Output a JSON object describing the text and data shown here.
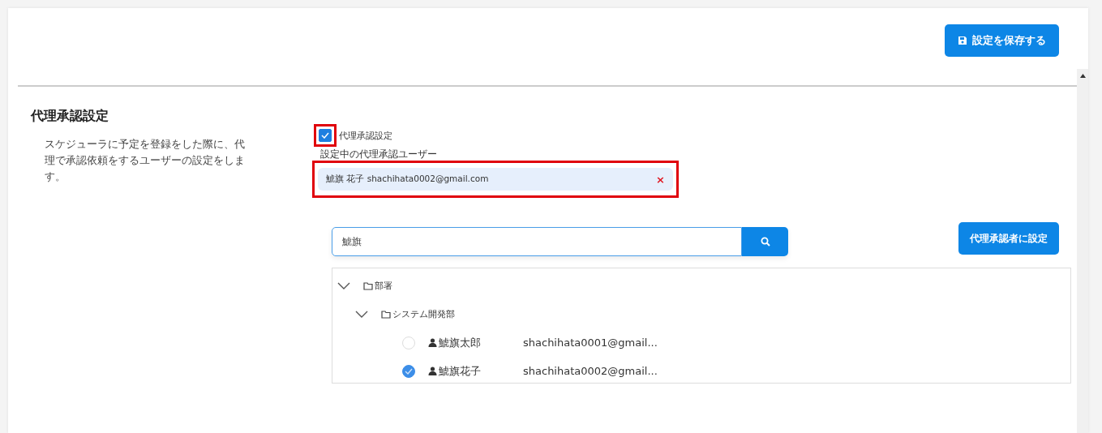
{
  "header": {
    "save_button": "設定を保存する"
  },
  "section": {
    "title": "代理承認設定",
    "description": "スケジューラに予定を登録をした際に、代理で承認依頼をするユーザーの設定をします。"
  },
  "proxy_checkbox": {
    "label": "代理承認設定",
    "checked": true,
    "highlighted": true
  },
  "current_user": {
    "label": "設定中の代理承認ユーザー",
    "chip": "鯱旗 花子 shachihata0002@gmail.com",
    "remove": "×",
    "highlighted": true
  },
  "search": {
    "value": "鯱旗"
  },
  "assign_button": "代理承認者に設定",
  "tree": [
    {
      "kind": "folder",
      "label": "部署",
      "expanded": true,
      "children": [
        {
          "kind": "folder",
          "label": "システム開発部",
          "expanded": true,
          "children": [
            {
              "kind": "user",
              "label": "鯱旗太郎",
              "email": "shachihata0001@gmail...",
              "selected": false
            },
            {
              "kind": "user",
              "label": "鯱旗花子",
              "email": "shachihata0002@gmail...",
              "selected": true
            }
          ]
        }
      ]
    }
  ]
}
